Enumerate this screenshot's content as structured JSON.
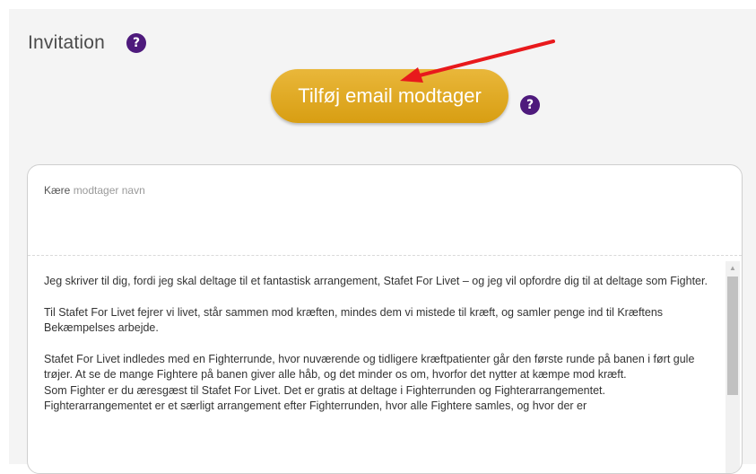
{
  "invitation": {
    "title": "Invitation",
    "help_symbol": "?",
    "add_recipient_label": "Tilføj email modtager",
    "button_help_symbol": "?"
  },
  "letter": {
    "greeting_prefix": "Kære",
    "greeting_placeholder": "modtager navn",
    "paragraphs": [
      "Jeg skriver til dig, fordi jeg skal deltage til et fantastisk arrangement, Stafet For Livet – og jeg vil opfordre dig til at deltage som Fighter.",
      "Til Stafet For Livet fejrer vi livet, står sammen mod kræften, mindes dem vi mistede til kræft, og samler penge ind til Kræftens Bekæmpelses arbejde.",
      "Stafet For Livet indledes med en Fighterrunde, hvor nuværende og tidligere kræftpatienter går den første runde på banen i ført gule trøjer. At se de mange Fightere på banen giver alle håb, og det minder os om, hvorfor det nytter at kæmpe mod kræft.",
      "Som Fighter er du æresgæst til Stafet For Livet. Det er gratis at deltage i Fighterrunden og Fighterarrangementet. Fighterarrangementet er et særligt arrangement efter Fighterrunden, hvor alle Fightere samles, og hvor der er"
    ]
  },
  "colors": {
    "help_badge": "#4e1a7c",
    "button_top": "#e9b73a",
    "button_bottom": "#d89e12",
    "annotation_arrow": "#e8191c"
  },
  "icons": {
    "help": "question-mark-circle-icon",
    "scroll_up": "triangle-up-icon"
  }
}
